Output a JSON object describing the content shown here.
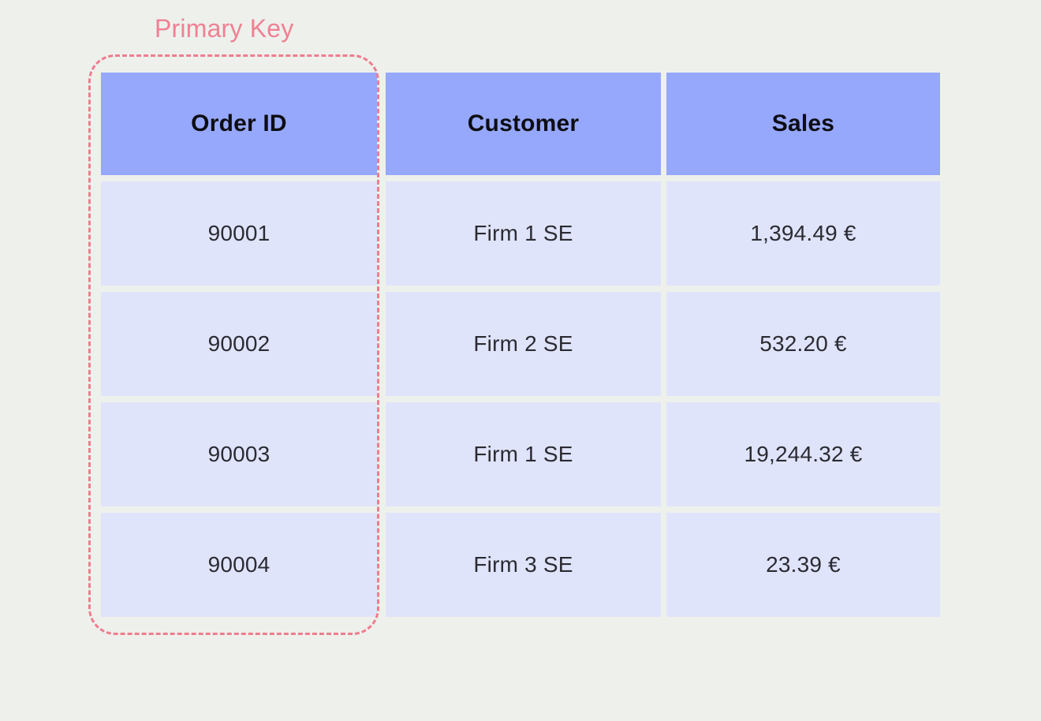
{
  "annotation": {
    "label": "Primary Key",
    "color": "#ee7d8e",
    "highlight_target_column": "Order ID",
    "style": "dashed-rounded-box"
  },
  "theme": {
    "page_background": "#eef0ec",
    "header_background": "#96a8fc",
    "header_text": "#0d0d12",
    "cell_background": "#e0e4fa",
    "cell_text": "#2b2b33",
    "accent": "#ee7d8e"
  },
  "table": {
    "columns": [
      "Order ID",
      "Customer",
      "Sales"
    ],
    "rows": [
      [
        "90001",
        "Firm 1 SE",
        "1,394.49 €"
      ],
      [
        "90002",
        "Firm 2 SE",
        "532.20 €"
      ],
      [
        "90003",
        "Firm 1 SE",
        "19,244.32 €"
      ],
      [
        "90004",
        "Firm 3 SE",
        "23.39 €"
      ]
    ]
  }
}
